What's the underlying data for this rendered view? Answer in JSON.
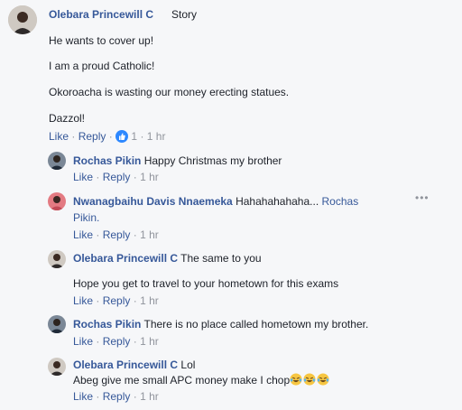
{
  "main_comment": {
    "author": "Olebara Princewill C",
    "label": "Story",
    "paragraphs": [
      "He wants to cover up!",
      "I am a proud Catholic!",
      "Okoroacha is wasting our money erecting statues.",
      "Dazzol!"
    ],
    "like": "Like",
    "reply": "Reply",
    "reaction_count": "1",
    "time": "1 hr"
  },
  "replies": [
    {
      "author": "Rochas Pikin",
      "text": "Happy Christmas my brother",
      "like": "Like",
      "reply": "Reply",
      "time": "1 hr"
    },
    {
      "author": "Nwanagbaihu Davis Nnaemeka",
      "text": "Hahahahahaha...",
      "mention_part1": "Rochas",
      "mention_part2": "Pikin.",
      "like": "Like",
      "reply": "Reply",
      "time": "1 hr",
      "options_icon": "more-horizontal-icon"
    },
    {
      "author": "Olebara Princewill C",
      "text": "The same to you",
      "text2": "Hope you get to travel to your hometown for this exams",
      "like": "Like",
      "reply": "Reply",
      "time": "1 hr"
    },
    {
      "author": "Rochas Pikin",
      "text": "There is no place called hometown my brother.",
      "like": "Like",
      "reply": "Reply",
      "time": "1 hr"
    },
    {
      "author": "Olebara Princewill C",
      "text": "Lol",
      "text2": "Abeg give me small APC money make I chop",
      "emoji": "laughing-tears-emoji",
      "like": "Like",
      "reply": "Reply",
      "time": "1 hr"
    }
  ],
  "colors": {
    "name": "#365899",
    "text": "#1d2129",
    "meta": "#90949c",
    "like_reaction": "#2d88ff"
  }
}
